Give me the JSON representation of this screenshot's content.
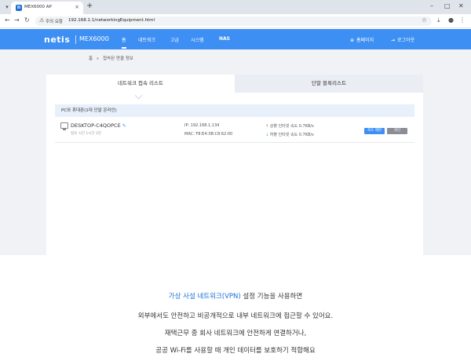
{
  "browser": {
    "tab_title": "MEX6000 AP",
    "url": "192.168.1.1/networkingEquipment.html",
    "security_label": "주의 요함",
    "minimize": "–",
    "maximize": "□",
    "close": "✕"
  },
  "header": {
    "logo": "netis",
    "model": "MEX6000",
    "nav": [
      "홈",
      "네트워크",
      "고급",
      "시스템",
      "NAS"
    ],
    "feedback": "홈페이지",
    "logout": "로그아웃"
  },
  "breadcrumb": {
    "home": "홈",
    "separator": "»",
    "current": "접속된 연결 정보"
  },
  "tabs": {
    "connected": "네트워크 접속 리스트",
    "blocked": "단말 블록리스트"
  },
  "section": {
    "title": "PC와 휴대폰(1대 단말 온라인)"
  },
  "device": {
    "name": "DESKTOP-C4QOPCE",
    "time": "접속 시간 1시간 2분",
    "ip": "IP: 192.168.1.134",
    "mac": "MAC: F8:E4:3B:C8:62:00",
    "upload": "상향 인터넷 속도 0.7KB/s",
    "download": "하향 인터넷 속도 0.7KB/s",
    "limit_label": "속도 제한",
    "block_label": "차단"
  },
  "caption": {
    "line1_highlight": "가상 사설 네트워크(VPN)",
    "line1_rest": " 설정 기능을 사용하면",
    "line2": "외부에서도 안전하고 비공개적으로 내부 네트워크에 접근할 수 있어요.",
    "line3": "재택근무 중 회사 네트워크에 안전하게 연결하거나,",
    "line4": "공공 Wi-Fi를 사용할 때 개인 데이터를 보호하기 적합해요"
  },
  "colors": {
    "header": "#3d8ff4",
    "page_bg": "#f1f2f6",
    "caption_highlight": "#1b6fd6"
  }
}
